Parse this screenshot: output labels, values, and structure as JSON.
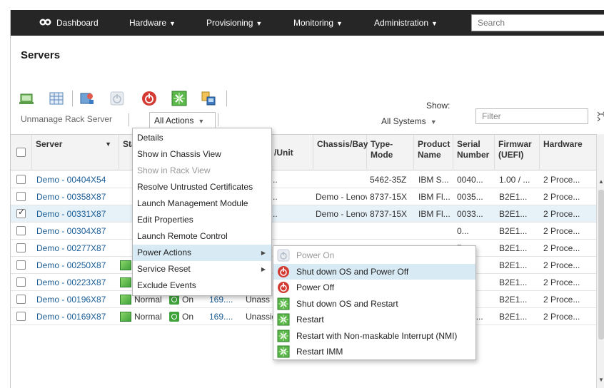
{
  "nav": {
    "dashboard": "Dashboard",
    "hardware": "Hardware",
    "provisioning": "Provisioning",
    "monitoring": "Monitoring",
    "administration": "Administration",
    "search_placeholder": "Search"
  },
  "page": {
    "title": "Servers"
  },
  "toolbar": {
    "unmanage_label": "Unmanage Rack Server",
    "all_actions_label": "All Actions",
    "show_label": "Show:",
    "show_value": "All Systems",
    "filter_placeholder": "Filter"
  },
  "columns": {
    "server": "Server",
    "status": "Sta",
    "unit": "/Unit",
    "chassis_bay": "Chassis/Bay",
    "type_model": "Type-Mode",
    "product_name": "Product Name",
    "serial_number": "Serial Number",
    "firmware": "Firmwar (UEFI)",
    "hardware": "Hardware"
  },
  "rows": [
    {
      "server": "Demo - 00404X54",
      "status": "",
      "power": "",
      "ip": "",
      "unit": "ssigne...",
      "chassis": "",
      "type": "5462-35Z",
      "product": "IBM S...",
      "serial": "0040...",
      "firmware": "1.00 / ...",
      "hardware": "2 Proce...",
      "checked": false
    },
    {
      "server": "Demo - 00358X87",
      "status": "",
      "power": "",
      "ip": "",
      "unit": "ssigne...",
      "chassis": "Demo - Lenov",
      "type": "8737-15X",
      "product": "IBM Fl...",
      "serial": "0035...",
      "firmware": "B2E1...",
      "hardware": "2 Proce...",
      "checked": false
    },
    {
      "server": "Demo - 00331X87",
      "status": "",
      "power": "",
      "ip": "",
      "unit": "ssigne...",
      "chassis": "Demo - Lenov",
      "type": "8737-15X",
      "product": "IBM Fl...",
      "serial": "0033...",
      "firmware": "B2E1...",
      "hardware": "2 Proce...",
      "checked": true
    },
    {
      "server": "Demo - 00304X87",
      "status": "",
      "power": "",
      "ip": "",
      "unit": "",
      "chassis": "",
      "type": "",
      "product": "",
      "serial": "0...",
      "firmware": "B2E1...",
      "hardware": "2 Proce...",
      "checked": false
    },
    {
      "server": "Demo - 00277X87",
      "status": "",
      "power": "",
      "ip": "",
      "unit": "",
      "chassis": "",
      "type": "",
      "product": "",
      "serial": "7...",
      "firmware": "B2E1...",
      "hardware": "2 Proce...",
      "checked": false
    },
    {
      "server": "Demo - 00250X87",
      "status": "Normal",
      "power": "On",
      "ip": "169....",
      "unit": "Unass",
      "chassis": "",
      "type": "",
      "product": "",
      "serial": "5...",
      "firmware": "B2E1...",
      "hardware": "2 Proce...",
      "checked": false
    },
    {
      "server": "Demo - 00223X87",
      "status": "Normal",
      "power": "On",
      "ip": "169....",
      "unit": "Unass",
      "chassis": "",
      "type": "",
      "product": "",
      "serial": "2...",
      "firmware": "B2E1...",
      "hardware": "2 Proce...",
      "checked": false
    },
    {
      "server": "Demo - 00196X87",
      "status": "Normal",
      "power": "On",
      "ip": "169....",
      "unit": "Unass",
      "chassis": "",
      "type": "",
      "product": "",
      "serial": "9...",
      "firmware": "B2E1...",
      "hardware": "2 Proce...",
      "checked": false
    },
    {
      "server": "Demo - 00169X87",
      "status": "Normal",
      "power": "On",
      "ip": "169....",
      "unit": "Unassigne...",
      "chassis": "Demo - Lenov",
      "type": "8737-15X",
      "product": "IBM Fl...",
      "serial": "0016...",
      "firmware": "B2E1...",
      "hardware": "2 Proce...",
      "checked": false
    }
  ],
  "actions_menu": {
    "items": [
      {
        "label": "Details",
        "disabled": false,
        "submenu": false,
        "highlighted": false
      },
      {
        "label": "Show in Chassis View",
        "disabled": false,
        "submenu": false,
        "highlighted": false
      },
      {
        "label": "Show in Rack View",
        "disabled": true,
        "submenu": false,
        "highlighted": false
      },
      {
        "label": "Resolve Untrusted Certificates",
        "disabled": false,
        "submenu": false,
        "highlighted": false
      },
      {
        "label": "Launch Management Module",
        "disabled": false,
        "submenu": false,
        "highlighted": false
      },
      {
        "label": "Edit Properties",
        "disabled": false,
        "submenu": false,
        "highlighted": false
      },
      {
        "label": "Launch Remote Control",
        "disabled": false,
        "submenu": false,
        "highlighted": false
      },
      {
        "label": "Power Actions",
        "disabled": false,
        "submenu": true,
        "highlighted": true
      },
      {
        "label": "Service Reset",
        "disabled": false,
        "submenu": true,
        "highlighted": false
      },
      {
        "label": "Exclude Events",
        "disabled": false,
        "submenu": false,
        "highlighted": false
      }
    ]
  },
  "power_menu": {
    "items": [
      {
        "label": "Power On",
        "icon": "power-on-disabled-icon",
        "disabled": true,
        "highlighted": false
      },
      {
        "label": "Shut down OS and Power Off",
        "icon": "power-off-icon",
        "disabled": false,
        "highlighted": true
      },
      {
        "label": "Power Off",
        "icon": "power-off-icon",
        "disabled": false,
        "highlighted": false
      },
      {
        "label": "Shut down OS and Restart",
        "icon": "restart-icon",
        "disabled": false,
        "highlighted": false
      },
      {
        "label": "Restart",
        "icon": "restart-icon",
        "disabled": false,
        "highlighted": false
      },
      {
        "label": "Restart with Non-maskable Interrupt (NMI)",
        "icon": "restart-icon",
        "disabled": false,
        "highlighted": false
      },
      {
        "label": "Restart IMM",
        "icon": "restart-icon",
        "disabled": false,
        "highlighted": false
      }
    ]
  },
  "colors": {
    "nav_bg": "#262626",
    "link": "#1b5d96",
    "menu_highlight": "#d8ebf5",
    "selected_row": "#e6f2f8",
    "power_red": "#d23a32",
    "ok_green": "#3fa33b"
  }
}
